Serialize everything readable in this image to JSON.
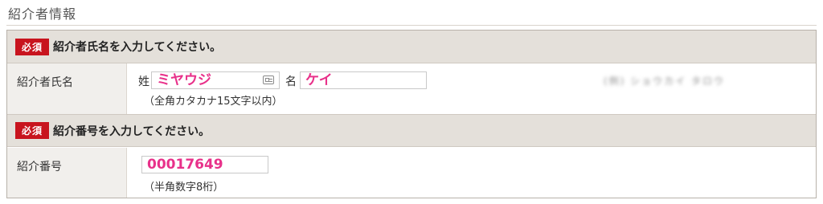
{
  "page": {
    "section_title": "紹介者情報"
  },
  "band1": {
    "badge": "必須",
    "text": "紹介者氏名を入力してください。"
  },
  "row1": {
    "label": "紹介者氏名",
    "sei_label": "姓",
    "sei_value": "ミヤウジ",
    "mei_label": "名",
    "mei_value": "ケイ",
    "hint": "（全角カタカナ15文字以内）",
    "blurred_text": "(例) ショウカイ タロウ"
  },
  "band2": {
    "badge": "必須",
    "text": "紹介番号を入力してください。"
  },
  "row2": {
    "label": "紹介番号",
    "number_value": "00017649",
    "hint": "（半角数字8桁）"
  },
  "colors": {
    "required_badge": "#c8141e",
    "input_text": "#e8318a",
    "band_background": "#e4e0da",
    "label_background": "#f1efec"
  }
}
